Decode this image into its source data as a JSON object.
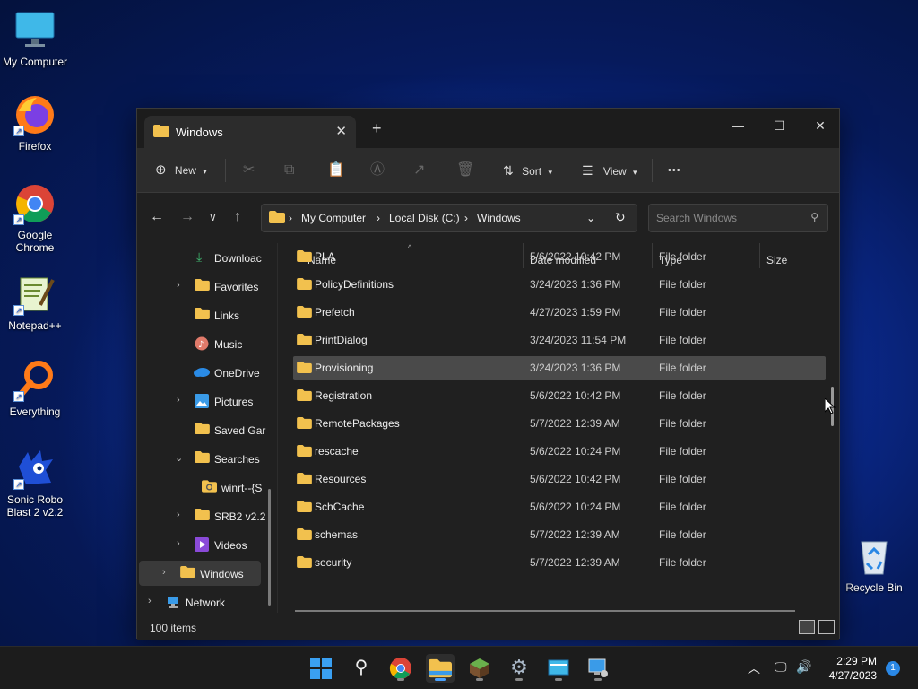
{
  "desktop": {
    "icons": [
      {
        "label": "My Computer"
      },
      {
        "label": "Firefox"
      },
      {
        "label": "Google Chrome"
      },
      {
        "label": "Notepad++"
      },
      {
        "label": "Everything"
      },
      {
        "label": "Sonic Robo Blast 2 v2.2"
      },
      {
        "label": "Recycle Bin"
      }
    ]
  },
  "window": {
    "tab_title": "Windows",
    "toolbar": {
      "new_label": "New",
      "sort_label": "Sort",
      "view_label": "View",
      "more_label": "•••"
    },
    "breadcrumb": [
      "My Computer",
      "Local Disk (C:)",
      "Windows"
    ],
    "search_placeholder": "Search Windows",
    "nav": [
      {
        "label": "Downloac",
        "icon": "download-icon"
      },
      {
        "label": "Favorites",
        "icon": "folder-icon"
      },
      {
        "label": "Links",
        "icon": "folder-icon"
      },
      {
        "label": "Music",
        "icon": "music-icon"
      },
      {
        "label": "OneDrive",
        "icon": "onedrive-icon"
      },
      {
        "label": "Pictures",
        "icon": "pictures-icon"
      },
      {
        "label": "Saved Gar",
        "icon": "folder-icon"
      },
      {
        "label": "Searches",
        "icon": "folder-icon"
      },
      {
        "label": "winrt--{S",
        "icon": "search-folder-icon"
      },
      {
        "label": "SRB2 v2.2",
        "icon": "folder-icon"
      },
      {
        "label": "Videos",
        "icon": "videos-icon"
      },
      {
        "label": "Windows",
        "icon": "folder-icon"
      },
      {
        "label": "Network",
        "icon": "network-icon"
      }
    ],
    "columns": {
      "name": "Name",
      "date": "Date modified",
      "type": "Type",
      "size": "Size"
    },
    "files": [
      {
        "name": "PLA",
        "date": "5/6/2022 10:42 PM",
        "type": "File folder"
      },
      {
        "name": "PolicyDefinitions",
        "date": "3/24/2023 1:36 PM",
        "type": "File folder"
      },
      {
        "name": "Prefetch",
        "date": "4/27/2023 1:59 PM",
        "type": "File folder"
      },
      {
        "name": "PrintDialog",
        "date": "3/24/2023 11:54 PM",
        "type": "File folder"
      },
      {
        "name": "Provisioning",
        "date": "3/24/2023 1:36 PM",
        "type": "File folder"
      },
      {
        "name": "Registration",
        "date": "5/6/2022 10:42 PM",
        "type": "File folder"
      },
      {
        "name": "RemotePackages",
        "date": "5/7/2022 12:39 AM",
        "type": "File folder"
      },
      {
        "name": "rescache",
        "date": "5/6/2022 10:24 PM",
        "type": "File folder"
      },
      {
        "name": "Resources",
        "date": "5/6/2022 10:42 PM",
        "type": "File folder"
      },
      {
        "name": "SchCache",
        "date": "5/6/2022 10:24 PM",
        "type": "File folder"
      },
      {
        "name": "schemas",
        "date": "5/7/2022 12:39 AM",
        "type": "File folder"
      },
      {
        "name": "security",
        "date": "5/7/2022 12:39 AM",
        "type": "File folder"
      }
    ],
    "status_count": "100 items"
  },
  "taskbar": {
    "time": "2:29 PM",
    "date": "4/27/2023",
    "notification_count": "1"
  },
  "colors": {
    "accent": "#4aa3ff",
    "folder": "#f2c14e",
    "window_bg": "#202020"
  }
}
